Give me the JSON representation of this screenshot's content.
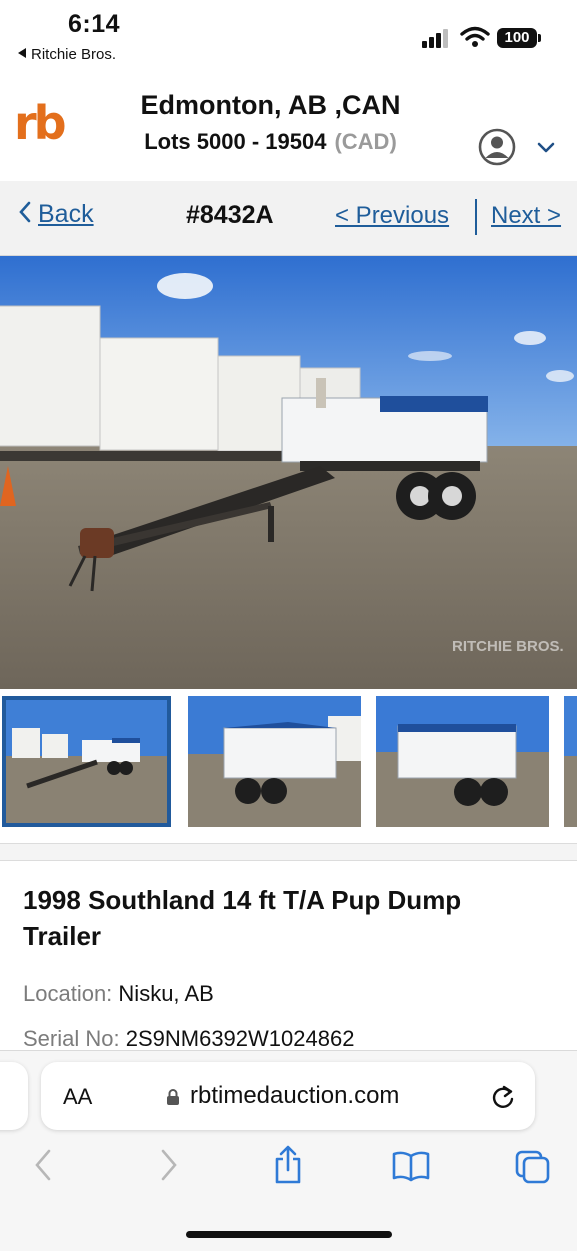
{
  "status_bar": {
    "time": "6:14",
    "back_app": "Ritchie Bros.",
    "battery": "100",
    "icons": [
      "cellular-signal-icon",
      "wifi-icon",
      "battery-icon"
    ]
  },
  "header": {
    "logo_text": "rb",
    "title": "Edmonton, AB ,CAN",
    "lots": "Lots 5000 - 19504",
    "currency": "(CAD)",
    "icons": [
      "user-account-icon",
      "chevron-down-icon"
    ]
  },
  "nav": {
    "back_label": "Back",
    "lot_number": "#8432A",
    "previous_label": "< Previous",
    "next_label": "Next >"
  },
  "gallery": {
    "main_image": "1998 Southland pup dump trailer in auction yard",
    "watermark": "RITCHIE BROS.",
    "thumbnail_count": 4,
    "selected_thumbnail": 1,
    "icons": [
      "chevron-left-icon",
      "chevron-right-icon"
    ]
  },
  "listing": {
    "title": "1998 Southland 14 ft T/A Pup Dump Trailer",
    "location_label": "Location:",
    "location_value": "Nisku, AB",
    "serial_label": "Serial No:",
    "serial_value": "2S9NM6392W1024862"
  },
  "safari": {
    "aa_label": "AA",
    "url": "rbtimedauction.com",
    "toolbar_icons": [
      "back-arrow-icon",
      "forward-arrow-icon",
      "share-icon",
      "bookmarks-icon",
      "tabs-icon"
    ]
  },
  "colors": {
    "brand_orange": "#e36f1c",
    "link_blue": "#1f5d9a",
    "ios_blue": "#2f7ad6"
  }
}
